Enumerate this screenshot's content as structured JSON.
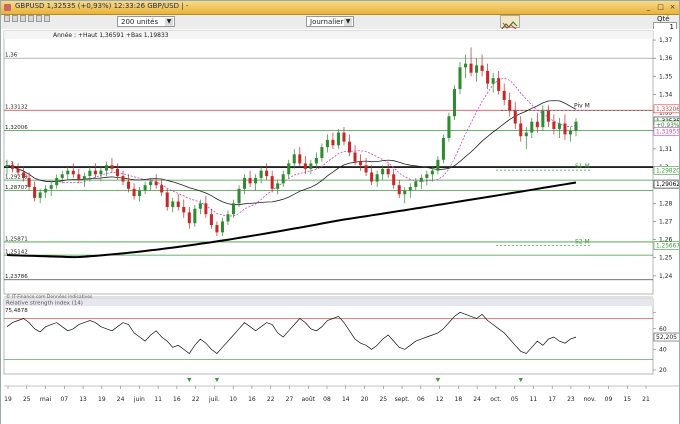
{
  "window": {
    "title": "GBPUSD  1,32535 (+0,93%)  12:33:26 GBP/USD | -",
    "minimize": "_",
    "maximize": "□",
    "close": "×"
  },
  "toolbar": {
    "units_select": "200 unités",
    "period_select": "Journalier",
    "qty_label": "Qté",
    "qty_value": "1"
  },
  "legend_line": "Année : +Haut 1,36591 +Bas 1,19833",
  "copyright": "© IT-Finance.com Données indicatives",
  "indicator_title": "Relative strength index (14)",
  "colors": {
    "up_candle": "#2e8b2e",
    "down_candle": "#c62828",
    "ma_dark": "#222222",
    "ma_pink": "#d040c0",
    "ma_long": "#000000",
    "green_level": "#3a9a3a",
    "red_level": "#d83a3a"
  },
  "chart_data": {
    "type": "candlestick",
    "title": "GBPUSD",
    "ylim": [
      1.23,
      1.375
    ],
    "y_ticks": [
      "1,37",
      "1,36",
      "1,35",
      "1,34",
      "1,33",
      "1,32",
      "1,31",
      "1,3",
      "1,29",
      "1,28",
      "1,27",
      "1,26",
      "1,25",
      "1,24"
    ],
    "x_ticks": [
      "19",
      "25",
      "mai",
      "07",
      "13",
      "19",
      "24",
      "juin",
      "11",
      "16",
      "22",
      "juil.",
      "10",
      "16",
      "22",
      "27",
      "août",
      "08",
      "14",
      "20",
      "25",
      "sept.",
      "06",
      "12",
      "18",
      "24",
      "oct.",
      "05",
      "11",
      "17",
      "23",
      "nov.",
      "09",
      "15",
      "21"
    ],
    "left_levels": [
      "1,36",
      "1,33132",
      "1,32006",
      "1,3",
      "1,29279",
      "1,28707",
      "1,25871",
      "1,25142",
      "1,23786"
    ],
    "right_labels": [
      {
        "text": "1,33206",
        "kind": "red"
      },
      {
        "text": "1,32535",
        "kind": "price"
      },
      {
        "text": "+0,93%",
        "kind": "change"
      },
      {
        "text": "1,31955",
        "kind": "pink"
      },
      {
        "text": "1,29820",
        "kind": "green"
      },
      {
        "text": "1,29062",
        "kind": "black"
      },
      {
        "text": "1,25667",
        "kind": "green"
      }
    ],
    "annotations": [
      "Piv M",
      "S1 M",
      "S2 M"
    ],
    "candles": [
      [
        1.3,
        1.304,
        1.296,
        1.301
      ],
      [
        1.301,
        1.303,
        1.297,
        1.299
      ],
      [
        1.299,
        1.302,
        1.295,
        1.297
      ],
      [
        1.297,
        1.3,
        1.292,
        1.294
      ],
      [
        1.294,
        1.297,
        1.287,
        1.289
      ],
      [
        1.289,
        1.292,
        1.281,
        1.283
      ],
      [
        1.283,
        1.288,
        1.28,
        1.286
      ],
      [
        1.286,
        1.29,
        1.283,
        1.288
      ],
      [
        1.288,
        1.292,
        1.284,
        1.29
      ],
      [
        1.29,
        1.296,
        1.288,
        1.294
      ],
      [
        1.294,
        1.298,
        1.291,
        1.296
      ],
      [
        1.296,
        1.3,
        1.293,
        1.298
      ],
      [
        1.298,
        1.302,
        1.294,
        1.296
      ],
      [
        1.296,
        1.299,
        1.291,
        1.293
      ],
      [
        1.293,
        1.297,
        1.289,
        1.295
      ],
      [
        1.295,
        1.3,
        1.292,
        1.298
      ],
      [
        1.298,
        1.302,
        1.294,
        1.296
      ],
      [
        1.296,
        1.3,
        1.292,
        1.298
      ],
      [
        1.298,
        1.303,
        1.295,
        1.301
      ],
      [
        1.301,
        1.305,
        1.297,
        1.299
      ],
      [
        1.299,
        1.302,
        1.293,
        1.295
      ],
      [
        1.295,
        1.298,
        1.29,
        1.292
      ],
      [
        1.292,
        1.296,
        1.286,
        1.288
      ],
      [
        1.288,
        1.291,
        1.282,
        1.284
      ],
      [
        1.284,
        1.289,
        1.281,
        1.287
      ],
      [
        1.287,
        1.292,
        1.285,
        1.29
      ],
      [
        1.29,
        1.294,
        1.287,
        1.292
      ],
      [
        1.292,
        1.296,
        1.288,
        1.29
      ],
      [
        1.29,
        1.293,
        1.284,
        1.286
      ],
      [
        1.286,
        1.288,
        1.276,
        1.278
      ],
      [
        1.278,
        1.283,
        1.275,
        1.281
      ],
      [
        1.281,
        1.285,
        1.276,
        1.278
      ],
      [
        1.278,
        1.282,
        1.272,
        1.275
      ],
      [
        1.275,
        1.278,
        1.266,
        1.269
      ],
      [
        1.269,
        1.279,
        1.267,
        1.277
      ],
      [
        1.277,
        1.282,
        1.274,
        1.28
      ],
      [
        1.28,
        1.284,
        1.272,
        1.274
      ],
      [
        1.274,
        1.277,
        1.266,
        1.268
      ],
      [
        1.268,
        1.27,
        1.262,
        1.264
      ],
      [
        1.264,
        1.272,
        1.262,
        1.27
      ],
      [
        1.27,
        1.276,
        1.268,
        1.274
      ],
      [
        1.274,
        1.282,
        1.272,
        1.28
      ],
      [
        1.28,
        1.29,
        1.278,
        1.288
      ],
      [
        1.288,
        1.296,
        1.285,
        1.294
      ],
      [
        1.294,
        1.298,
        1.289,
        1.291
      ],
      [
        1.291,
        1.296,
        1.287,
        1.294
      ],
      [
        1.294,
        1.3,
        1.291,
        1.298
      ],
      [
        1.298,
        1.302,
        1.293,
        1.295
      ],
      [
        1.295,
        1.298,
        1.286,
        1.288
      ],
      [
        1.288,
        1.293,
        1.285,
        1.291
      ],
      [
        1.291,
        1.298,
        1.289,
        1.296
      ],
      [
        1.296,
        1.304,
        1.294,
        1.302
      ],
      [
        1.302,
        1.31,
        1.299,
        1.307
      ],
      [
        1.307,
        1.311,
        1.3,
        1.302
      ],
      [
        1.302,
        1.306,
        1.296,
        1.299
      ],
      [
        1.299,
        1.304,
        1.296,
        1.302
      ],
      [
        1.302,
        1.308,
        1.299,
        1.305
      ],
      [
        1.305,
        1.313,
        1.303,
        1.311
      ],
      [
        1.311,
        1.318,
        1.308,
        1.315
      ],
      [
        1.315,
        1.319,
        1.31,
        1.312
      ],
      [
        1.312,
        1.321,
        1.31,
        1.319
      ],
      [
        1.319,
        1.322,
        1.312,
        1.314
      ],
      [
        1.314,
        1.318,
        1.306,
        1.308
      ],
      [
        1.308,
        1.312,
        1.301,
        1.303
      ],
      [
        1.303,
        1.307,
        1.298,
        1.301
      ],
      [
        1.301,
        1.305,
        1.295,
        1.297
      ],
      [
        1.297,
        1.301,
        1.29,
        1.292
      ],
      [
        1.292,
        1.298,
        1.289,
        1.296
      ],
      [
        1.296,
        1.301,
        1.293,
        1.299
      ],
      [
        1.299,
        1.302,
        1.294,
        1.296
      ],
      [
        1.296,
        1.299,
        1.288,
        1.29
      ],
      [
        1.29,
        1.293,
        1.283,
        1.285
      ],
      [
        1.285,
        1.289,
        1.28,
        1.287
      ],
      [
        1.287,
        1.291,
        1.283,
        1.289
      ],
      [
        1.289,
        1.294,
        1.287,
        1.292
      ],
      [
        1.292,
        1.296,
        1.288,
        1.294
      ],
      [
        1.294,
        1.298,
        1.29,
        1.296
      ],
      [
        1.296,
        1.3,
        1.292,
        1.298
      ],
      [
        1.298,
        1.306,
        1.296,
        1.304
      ],
      [
        1.304,
        1.318,
        1.302,
        1.316
      ],
      [
        1.316,
        1.33,
        1.314,
        1.328
      ],
      [
        1.328,
        1.345,
        1.326,
        1.343
      ],
      [
        1.343,
        1.358,
        1.34,
        1.355
      ],
      [
        1.355,
        1.362,
        1.349,
        1.357
      ],
      [
        1.357,
        1.366,
        1.35,
        1.352
      ],
      [
        1.352,
        1.36,
        1.347,
        1.356
      ],
      [
        1.356,
        1.362,
        1.35,
        1.353
      ],
      [
        1.353,
        1.357,
        1.343,
        1.346
      ],
      [
        1.346,
        1.352,
        1.341,
        1.349
      ],
      [
        1.349,
        1.353,
        1.34,
        1.342
      ],
      [
        1.342,
        1.346,
        1.334,
        1.337
      ],
      [
        1.337,
        1.341,
        1.328,
        1.331
      ],
      [
        1.331,
        1.336,
        1.321,
        1.324
      ],
      [
        1.324,
        1.328,
        1.314,
        1.317
      ],
      [
        1.317,
        1.322,
        1.31,
        1.319
      ],
      [
        1.319,
        1.327,
        1.316,
        1.325
      ],
      [
        1.325,
        1.33,
        1.319,
        1.322
      ],
      [
        1.322,
        1.334,
        1.32,
        1.331
      ],
      [
        1.331,
        1.334,
        1.322,
        1.325
      ],
      [
        1.325,
        1.329,
        1.318,
        1.321
      ],
      [
        1.321,
        1.327,
        1.316,
        1.324
      ],
      [
        1.324,
        1.329,
        1.315,
        1.318
      ],
      [
        1.318,
        1.322,
        1.314,
        1.32
      ],
      [
        1.32,
        1.327,
        1.317,
        1.325
      ]
    ],
    "rsi": {
      "ylim": [
        20,
        85
      ],
      "ticks": [
        "75,4878",
        "60",
        "40",
        "20"
      ],
      "current": "52,205",
      "levels": [
        70,
        30
      ],
      "values": [
        62,
        66,
        68,
        70,
        66,
        60,
        57,
        62,
        64,
        66,
        62,
        58,
        60,
        64,
        66,
        68,
        66,
        62,
        60,
        58,
        62,
        66,
        64,
        56,
        52,
        48,
        54,
        58,
        52,
        48,
        42,
        44,
        40,
        36,
        44,
        50,
        46,
        40,
        36,
        42,
        48,
        54,
        60,
        66,
        62,
        58,
        62,
        66,
        64,
        56,
        52,
        58,
        64,
        70,
        66,
        60,
        58,
        62,
        68,
        70,
        72,
        66,
        58,
        50,
        46,
        44,
        40,
        44,
        50,
        54,
        48,
        42,
        40,
        44,
        48,
        50,
        52,
        54,
        56,
        60,
        66,
        72,
        76,
        74,
        72,
        70,
        74,
        68,
        64,
        60,
        56,
        50,
        44,
        38,
        36,
        42,
        48,
        44,
        50,
        52,
        48,
        46,
        50,
        52
      ]
    },
    "markers": [
      {
        "index": 33
      },
      {
        "index": 38
      },
      {
        "index": 78
      },
      {
        "index": 93
      }
    ]
  }
}
